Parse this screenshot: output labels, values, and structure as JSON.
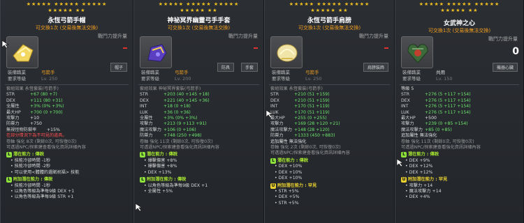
{
  "panels": [
    {
      "stars": "★★★★★ ★★★★★ ★★★★★\n★★★★★ ★★",
      "title": "永恆弓箭手帽",
      "subtitle": "可交換1次 (交易後無法交換)",
      "power_label": "戰鬥力提升量",
      "tag": "帽子",
      "req_class_label": "裝備職業",
      "req_class_value": "弓箭手",
      "req_level_label": "要求等級",
      "req_level_value": "Lv. 250",
      "set_line": "套組效果     永恆套裝(弓箭手)",
      "stats": [
        [
          "STR",
          "+67 (80 +7)"
        ],
        [
          "DEX",
          "+111 (80 +31)"
        ],
        [
          "全屬性",
          "+3% (0% +3%)"
        ],
        [
          "最大HP",
          "+700 (0 +700)"
        ],
        [
          "攻擊力",
          "+10"
        ],
        [
          "防禦力",
          "+750"
        ],
        [
          "無視怪物防禦率",
          "+15%"
        ]
      ],
      "notice": "在部分情況下為不可見的道具。",
      "upgrade": "卷軸 強化 8次  (剩餘0次, 可恢復0次)",
      "upgrade2": "可透過NPC/探索建查看強化資訊詳細內容",
      "potential_label": "潛在能力 : 傳說",
      "potential_lines": [
        "技能冷卻時間 -1秒",
        "技能冷卻時間 -2秒",
        "可以使用<體體的遺賦祝福> 技能"
      ],
      "add_potential_label": "附加潛在能力 : 傳說",
      "add_potential_lines": [
        "技能冷卻時間 -1秒",
        "以角色等級為準每9級 DEX +1",
        "以角色等級為準每9級 STR +1"
      ]
    },
    {
      "stars": "★★★★★ ★★★★★ ★★★★★\n★★★★★ ★★",
      "title": "神祕冥界幽靈弓手手套",
      "subtitle": "可交換1次 (交易後無法交換)",
      "power_label": "戰鬥力提升量",
      "tag1": "防具",
      "tag2": "手套",
      "req_class_label": "裝備職業",
      "req_class_value": "弓箭手",
      "req_level_label": "要求等級",
      "req_level_value": "Lv. 200",
      "set_line": "套組效果     神祕冥界套裝(弓箭手)",
      "stats": [
        [
          "STR",
          "+203 (40 +145 +18)"
        ],
        [
          "DEX",
          "+221 (40 +145 +36)"
        ],
        [
          "INT",
          "+18 (0 +18)"
        ],
        [
          "LUK",
          "+36 (0 +36)"
        ],
        [
          "全屬性",
          "+3% (0% +3%)"
        ],
        [
          "攻擊力",
          "+213 (9 +113 +91)"
        ],
        [
          "魔法攻擊力",
          "+106 (0 +106)"
        ],
        [
          "防禦力",
          "+748 (250 +498)"
        ]
      ],
      "upgrade": "卷軸 強化 11次  (剩餘0次, 可恢復0次)",
      "upgrade2": "可透過NPC/探索建查看強化資訊詳細內容",
      "potential_label": "潛在能力 : 傳說",
      "potential_lines": [
        "爆擊傷害 +8%",
        "爆擊傷害 +8%",
        "DEX +13%"
      ],
      "add_potential_label": "附加潛在能力 : 傳說",
      "add_potential_lines": [
        "以角色等級為準每9級 DEX +1",
        "全屬性 +5%"
      ]
    },
    {
      "stars": "★★★★★ ★★★★★ ★★★★★\n★★★★★ ★★",
      "title": "永恆弓箭手肩膀",
      "subtitle": "可交換1次 (交易後無法交換)",
      "power_label": "戰鬥力提升量",
      "tag": "肩膀裝飾",
      "req_class_label": "裝備職業",
      "req_class_value": "弓箭手",
      "req_level_label": "要求等級",
      "req_level_value": "Lv. 250",
      "set_line": "套組效果     永恆套裝(弓箭手)",
      "stats": [
        [
          "STR",
          "+210 (51 +159)"
        ],
        [
          "DEX",
          "+210 (51 +159)"
        ],
        [
          "INT",
          "+170 (51 +119)"
        ],
        [
          "LUK",
          "+170 (51 +119)"
        ],
        [
          "最大HP",
          "+255 (0 +255)"
        ],
        [
          "攻擊力",
          "+169 (28 +120 +21)"
        ],
        [
          "魔法攻擊力",
          "+148 (28 +120)"
        ],
        [
          "防禦力",
          "+1333 (450 +883)"
        ]
      ],
      "extra": "追加屬性 無法強化",
      "upgrade": "卷軸 強化 2次  (剩餘0次, 可恢復0次)",
      "upgrade2": "可透過NPC/探索建查看強化資訊詳細內容",
      "potential_label": "潛在能力 : 傳說",
      "potential_lines": [
        "DEX +10%",
        "DEX +10%",
        "DEX +10%"
      ],
      "add_potential_label": "附加潛在能力 : 罕見",
      "add_potential_lines": [
        "STR +5%",
        "DEX +5%",
        "STR +5%"
      ]
    },
    {
      "stars": "★★★★★ ★★★★★ ★★★★★\n★★★★★ ★★",
      "title": "女武神之心",
      "subtitle": "可交換1次 (交易後無法交換)",
      "power_label": "戰鬥力提升量",
      "power_value": "0",
      "tag": "機器心臟",
      "req_class_label": "裝備職業",
      "req_class_value": "共用",
      "req_level_label": "要求等級",
      "req_level_value": "Lv. 150",
      "level_line": "等級    5",
      "stats": [
        [
          "STR",
          "+276 (5 +117 +154)"
        ],
        [
          "DEX",
          "+276 (5 +117 +154)"
        ],
        [
          "INT",
          "+276 (5 +117 +154)"
        ],
        [
          "LUK",
          "+276 (5 +117 +154)"
        ],
        [
          "最大HP",
          "+500"
        ],
        [
          "攻擊力",
          "+239 (0 +85 +154)"
        ],
        [
          "魔法攻擊力",
          "+85 (0 +85)"
        ]
      ],
      "extra": "追加屬性 無法強化",
      "upgrade": "卷軸 強化 11次  (剩餘0次, 可恢復0次)",
      "upgrade2": "可透過NPC/探索建查看強化資訊詳細內容",
      "potential_label": "潛在能力 : 傳說",
      "potential_lines": [
        "DEX +9%",
        "DEX +12%",
        "DEX +12%"
      ],
      "add_potential_label": "附加潛在能力 : 罕見",
      "add_potential_lines": [
        "攻擊力 +14",
        "魔法攻擊力 +14",
        "DEX +4%"
      ]
    }
  ]
}
